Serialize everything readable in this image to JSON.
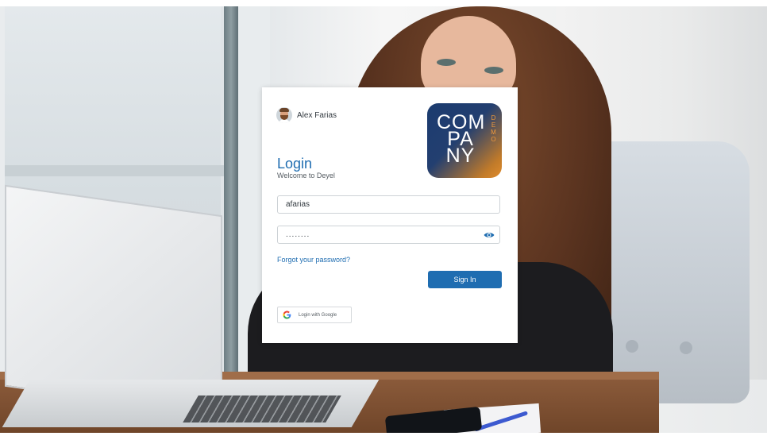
{
  "user": {
    "name": "Alex Farias"
  },
  "logo": {
    "line1": "COM",
    "line2": "PA",
    "line3": "NY",
    "tag": "DEMO",
    "accent": "#e08c2c",
    "brand": "#1b3b6f"
  },
  "login": {
    "title": "Login",
    "subtitle": "Welcome to Deyel",
    "username_value": "afarias",
    "password_value": "........",
    "forgot_label": "Forgot your password?",
    "signin_label": "Sign In",
    "google_label": "Login with Google",
    "primary_color": "#1f6db1"
  },
  "icons": {
    "password_toggle": "eye-icon",
    "google": "google-icon",
    "avatar": "avatar"
  }
}
